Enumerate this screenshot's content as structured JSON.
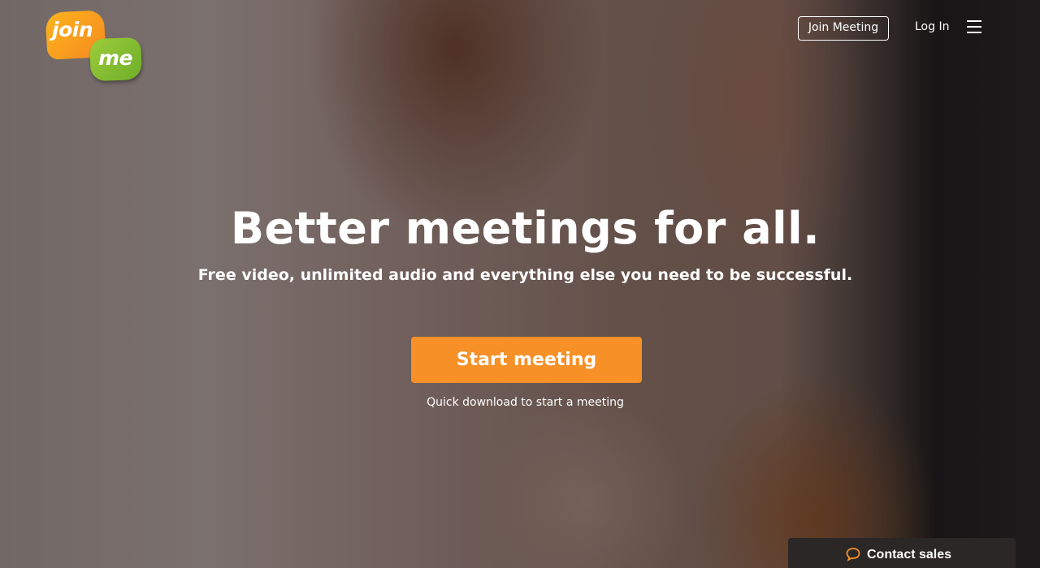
{
  "logo": {
    "top_word": "join",
    "bottom_word": "me",
    "colors": {
      "orange": "#f68a1f",
      "green": "#7cb82f"
    }
  },
  "header": {
    "join_meeting_label": "Join Meeting",
    "login_label": "Log In",
    "menu_icon": "hamburger-menu-icon"
  },
  "hero": {
    "title": "Better meetings for all.",
    "subtitle": "Free video, unlimited audio and everything else you need to be successful.",
    "cta_label": "Start meeting",
    "cta_color": "#f79027",
    "note": "Quick download to start a meeting"
  },
  "contact": {
    "label": "Contact sales",
    "icon": "chat-bubble-icon",
    "icon_color": "#f79027"
  }
}
